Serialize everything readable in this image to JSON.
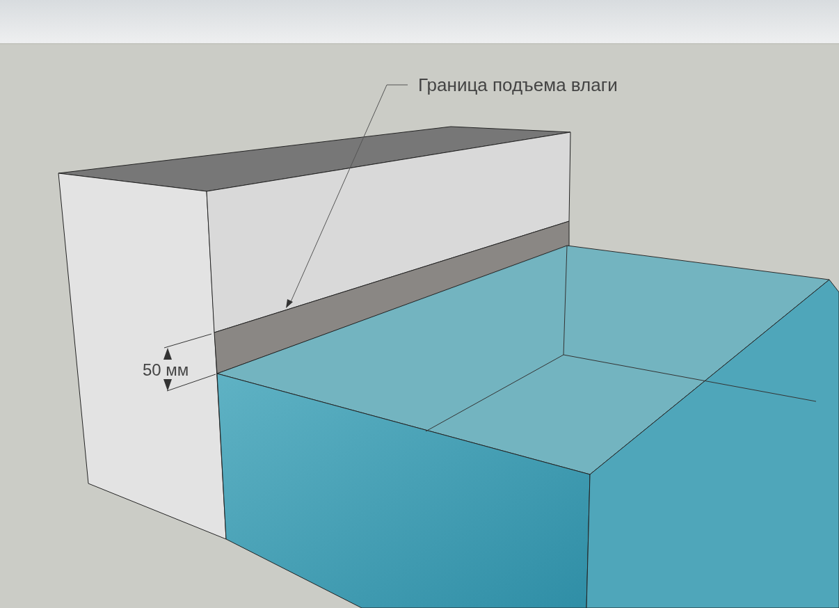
{
  "callouts": [
    {
      "kind": "leader",
      "text": "Граница подъема влаги"
    },
    {
      "kind": "dimension",
      "text": "50 мм"
    }
  ]
}
